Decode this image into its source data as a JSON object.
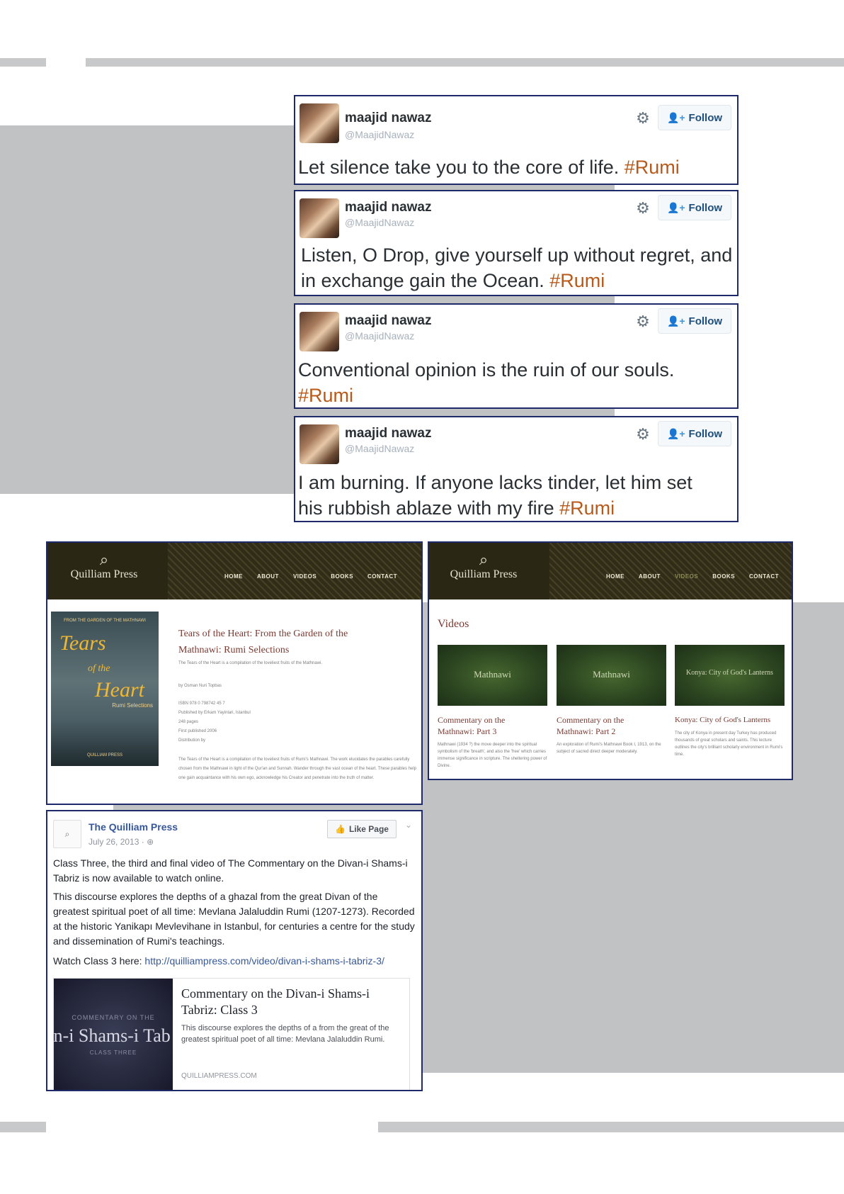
{
  "tweets": [
    {
      "name": "maajid nawaz",
      "handle": "@MaajidNawaz",
      "follow": "Follow",
      "text": "Let silence take you to the core of life. ",
      "tag": "#Rumi"
    },
    {
      "name": "maajid nawaz",
      "handle": "@MaajidNawaz",
      "follow": "Follow",
      "text": "Listen, O Drop, give yourself up without regret, and in exchange gain the Ocean. ",
      "tag": "#Rumi"
    },
    {
      "name": "maajid nawaz",
      "handle": "@MaajidNawaz",
      "follow": "Follow",
      "text": "Conventional opinion is the ruin of our souls. ",
      "tag": "#Rumi"
    },
    {
      "name": "maajid nawaz",
      "handle": "@MaajidNawaz",
      "follow": "Follow",
      "text": "I am burning. If anyone lacks tinder, let him set his rubbish ablaze with my fire ",
      "tag": "#Rumi"
    }
  ],
  "site": {
    "logo": "Quilliam Press",
    "nav": [
      "HOME",
      "ABOUT",
      "VIDEOS",
      "BOOKS",
      "CONTACT"
    ]
  },
  "book_page": {
    "cover": {
      "top_text": "FROM THE GARDEN OF THE MATHNAWI",
      "title_1": "Tears",
      "title_2": "of the",
      "title_3": "Heart",
      "subtitle": "Rumi Selections",
      "bottom_text": "QUILLIAM PRESS"
    },
    "title": "Tears of the Heart: From the Garden of the Mathnawi: Rumi Selections",
    "tagline": "The Tears of the Heart is a compilation of the loveliest fruits of the Mathnawi.",
    "author": "by Osman Nuri Topbas",
    "details": [
      "ISBN 978 0 798742 45 7",
      "Published by Erkam Yayinlari, Istanbul",
      "248 pages",
      "First published 2006",
      "Distribution by"
    ],
    "description": "The Tears of the Heart is a compilation of the loveliest fruits of Rumi's Mathnawi. The work elucidates the parables carefully chosen from the Mathnawi in light of the Qur'an and Sunnah. Wander through the vast ocean of the heart. These parables help one gain acquaintance with his own ego, acknowledge his Creator and penetrate into the truth of matter."
  },
  "videos_page": {
    "heading": "Videos",
    "videos": [
      {
        "thumb": "Mathnawi",
        "title": "Commentary on the Mathnawi: Part 3",
        "desc": "Mathnawi (1934 ?) the move deeper into the spiritual symbolism of the 'breath', and also the 'free' which carries immense significance in scripture. The sheltering power of Divine."
      },
      {
        "thumb": "Mathnawi",
        "title": "Commentary on the Mathnawi: Part 2",
        "desc": "An exploration of Rumi's Mathnawi Book I, 1913, on the subject of sacred direct deeper moderately."
      },
      {
        "thumb": "Konya: City of God's Lanterns",
        "title": "Konya: City of God's Lanterns",
        "desc": "The city of Konya in present day Turkey has produced thousands of great scholars and saints. This lecture outlines the city's brilliant scholarly environment in Rumi's time."
      }
    ]
  },
  "facebook": {
    "page_name": "The Quilliam Press",
    "date": "July 26, 2013 · ",
    "like_button": "Like Page",
    "p1": "Class Three, the third and final video of The Commentary on the Divan-i Shams-i Tabriz is now available to watch online.",
    "p2": "This discourse explores the depths of a ghazal from the great Divan of the greatest spiritual poet of all time: Mevlana Jalaluddin Rumi (1207-1273). Recorded at the historic Yanikapı Mevlevihane in Istanbul, for centuries a centre for the study and dissemination of Rumi's teachings.",
    "watch_label": "Watch Class 3 here: ",
    "watch_link": "http://quilliampress.com/video/divan-i-shams-i-tabriz-3/",
    "card": {
      "img_top": "COMMENTARY ON THE",
      "img_big": "an-i Shams-i Tab",
      "img_bottom": "CLASS THREE",
      "title": "Commentary on the Divan-i Shams-i Tabriz: Class 3",
      "desc": "This discourse explores the depths of a from the great of the greatest spiritual poet of all time: Mevlana Jalaluddin Rumi.",
      "domain": "QUILLIAMPRESS.COM"
    }
  }
}
